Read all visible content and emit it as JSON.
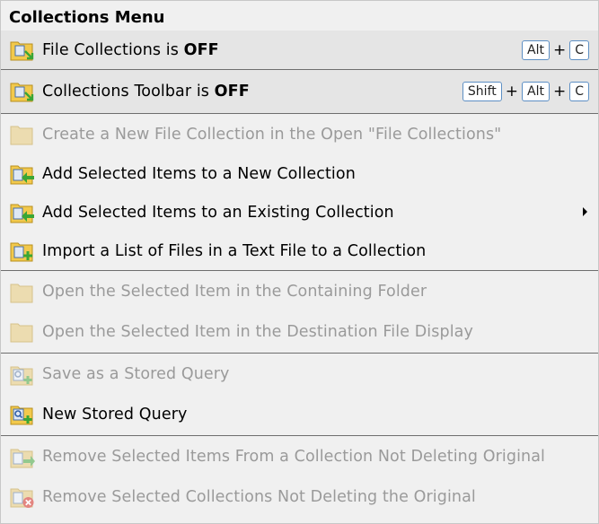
{
  "menu": {
    "title": "Collections Menu",
    "items": [
      {
        "name": "file-collections",
        "pre": "File Collections is ",
        "bold": "OFF",
        "icon": "folder-arrow-icon",
        "enabled": true,
        "shortcut": [
          "Alt",
          "C"
        ]
      },
      {
        "name": "collections-toolbar",
        "pre": "Collections Toolbar is ",
        "bold": "OFF",
        "icon": "folder-arrow-icon",
        "enabled": true,
        "shortcut": [
          "Shift",
          "Alt",
          "C"
        ]
      },
      {
        "name": "create-new-file-collection",
        "label": "Create a New File Collection in the Open \"File Collections\"",
        "icon": "folder-icon",
        "enabled": false
      },
      {
        "name": "add-to-new-collection",
        "label": "Add Selected Items to a New Collection",
        "icon": "folder-add-left-icon",
        "enabled": true
      },
      {
        "name": "add-to-existing-collection",
        "label": "Add Selected Items to an Existing Collection",
        "icon": "folder-add-left-icon",
        "enabled": true,
        "submenu": true
      },
      {
        "name": "import-list-to-collection",
        "label": "Import a List of Files in a Text File to a Collection",
        "icon": "folder-plus-icon",
        "enabled": true
      },
      {
        "name": "open-in-containing-folder",
        "label": "Open the Selected Item in the Containing Folder",
        "icon": "folder-icon",
        "enabled": false
      },
      {
        "name": "open-in-destination-display",
        "label": "Open the Selected Item in the Destination File Display",
        "icon": "folder-icon",
        "enabled": false
      },
      {
        "name": "save-stored-query",
        "label": "Save as a Stored Query",
        "icon": "query-plus-icon",
        "enabled": false
      },
      {
        "name": "new-stored-query",
        "label": "New Stored Query",
        "icon": "query-plus-icon",
        "enabled": true
      },
      {
        "name": "remove-items-from-collection",
        "label": "Remove Selected Items From a Collection Not Deleting Original",
        "icon": "folder-remove-arrow-icon",
        "enabled": false
      },
      {
        "name": "remove-collections",
        "label": "Remove Selected Collections Not Deleting the Original",
        "icon": "folder-delete-icon",
        "enabled": false
      }
    ]
  },
  "colors": {
    "menu_bg": "#f0f0f0",
    "highlight_bg": "#e5e5e5",
    "disabled_text": "#9a9a9a",
    "separator": "#6e6e6e",
    "folder_yellow": "#f2c94c",
    "arrow_green": "#3aa635",
    "delete_red": "#d9342b",
    "key_border": "#5d8fc4"
  }
}
